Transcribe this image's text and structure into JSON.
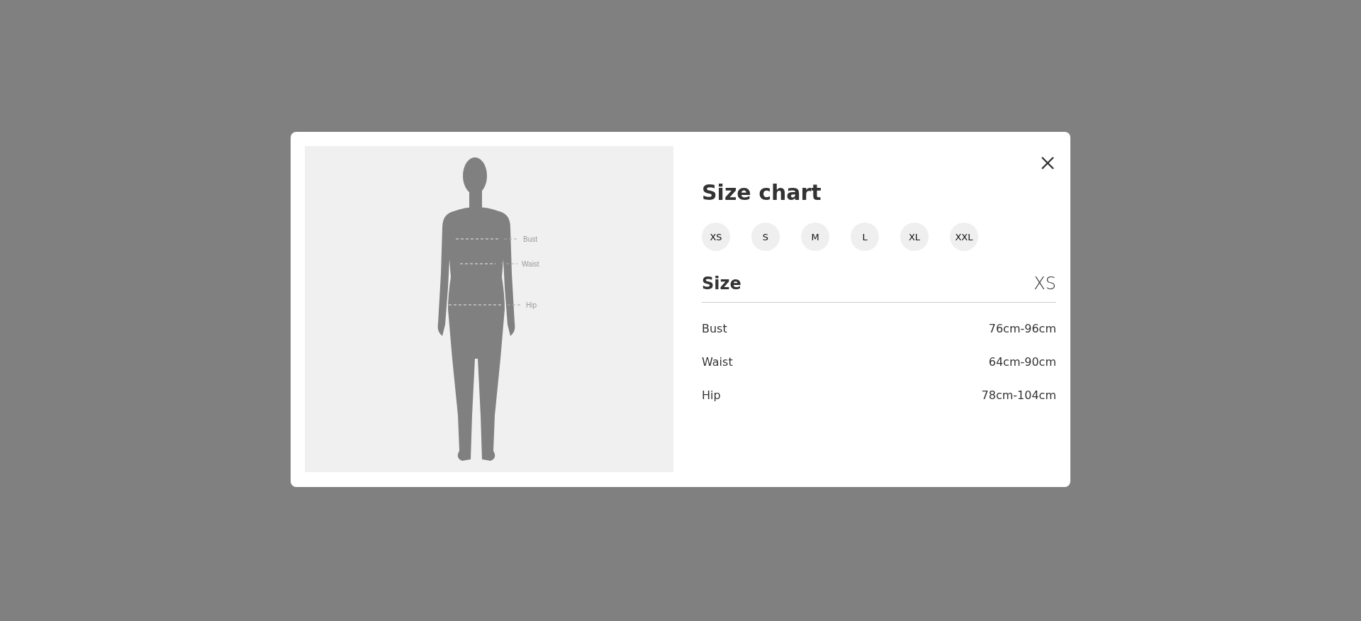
{
  "figure": {
    "labels": [
      "Bust",
      "Waist",
      "Hip"
    ]
  },
  "title": "Size chart",
  "sizes": [
    "XS",
    "S",
    "M",
    "L",
    "XL",
    "XXL"
  ],
  "size_table": {
    "heading": "Size",
    "current": "XS",
    "rows": [
      {
        "name": "Bust",
        "value": "76cm-96cm"
      },
      {
        "name": "Waist",
        "value": "64cm-90cm"
      },
      {
        "name": "Hip",
        "value": "78cm-104cm"
      }
    ]
  }
}
